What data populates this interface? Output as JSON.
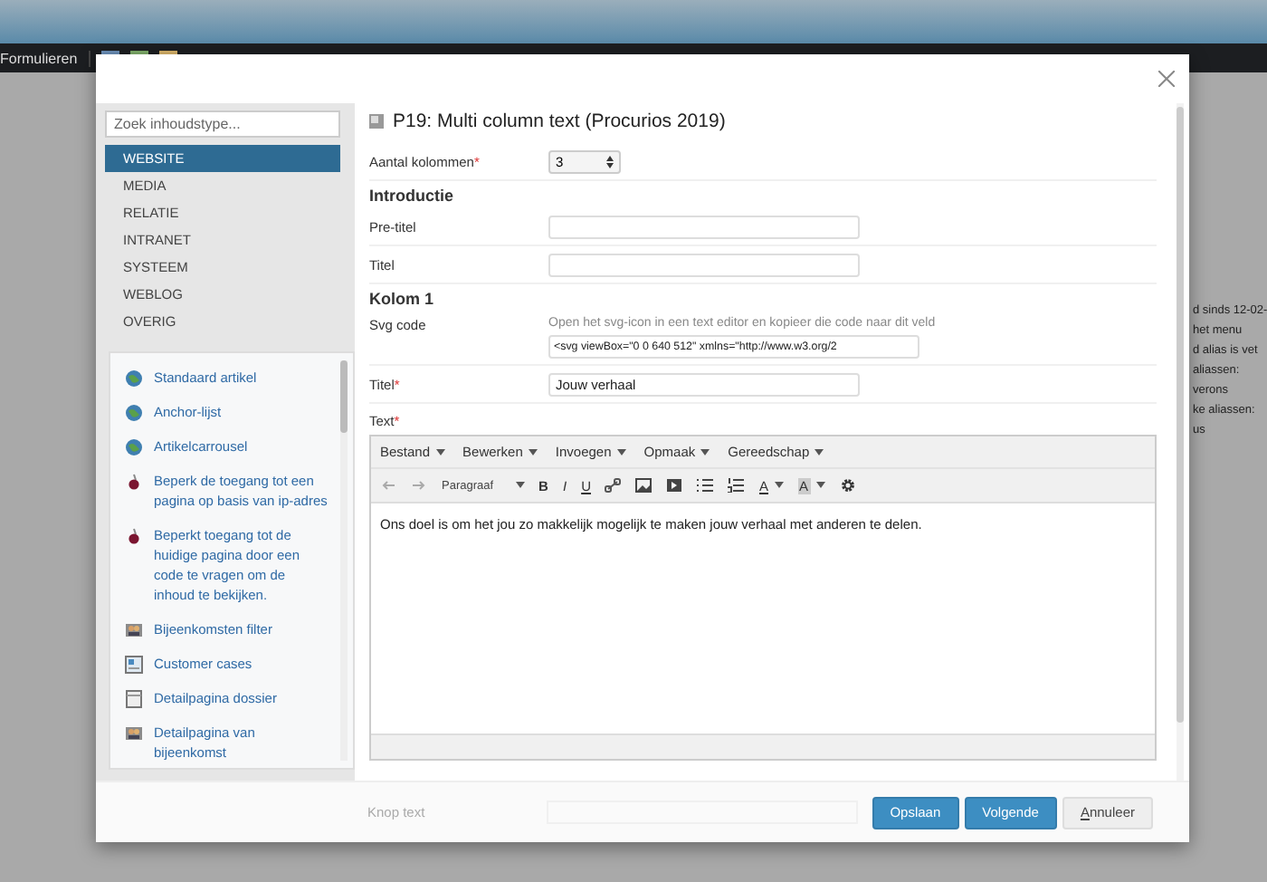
{
  "background": {
    "nav_items": [
      "Formulieren"
    ],
    "side_texts": [
      "d sinds 12-02-",
      "het menu",
      "d alias is vet",
      "aliassen:",
      "verons",
      "ke aliassen:",
      "us"
    ]
  },
  "modal": {
    "sidebar": {
      "search": {
        "placeholder": "Zoek inhoudstype..."
      },
      "categories": [
        {
          "label": "WEBSITE",
          "selected": true
        },
        {
          "label": "MEDIA",
          "selected": false
        },
        {
          "label": "RELATIE",
          "selected": false
        },
        {
          "label": "INTRANET",
          "selected": false
        },
        {
          "label": "SYSTEEM",
          "selected": false
        },
        {
          "label": "WEBLOG",
          "selected": false
        },
        {
          "label": "OVERIG",
          "selected": false
        }
      ],
      "content_types": [
        {
          "kind": "globe",
          "label": "Standaard artikel"
        },
        {
          "kind": "globe",
          "label": "Anchor-lijst"
        },
        {
          "kind": "globe",
          "label": "Artikelcarrousel"
        },
        {
          "kind": "pin",
          "label": "Beperk de toegang tot een pagina op basis van ip-adres"
        },
        {
          "kind": "pin",
          "label": "Beperkt toegang tot de huidige pagina door een code te vragen om de inhoud te bekijken."
        },
        {
          "kind": "group",
          "label": "Bijeenkomsten filter"
        },
        {
          "kind": "card",
          "label": "Customer cases"
        },
        {
          "kind": "page",
          "label": "Detailpagina dossier"
        },
        {
          "kind": "group",
          "label": "Detailpagina van bijeenkomst"
        }
      ]
    },
    "title": "P19: Multi column text (Procurios 2019)",
    "fields": [
      {
        "kind": "select",
        "label": "Aantal kolommen",
        "required_mark": "*",
        "value": "3"
      },
      {
        "kind": "heading",
        "label": "Introductie"
      },
      {
        "kind": "text",
        "label": "Pre-titel"
      },
      {
        "kind": "text",
        "label": "Titel"
      },
      {
        "kind": "heading",
        "label": "Kolom 1"
      },
      {
        "kind": "text",
        "label": "Svg code",
        "help": "Open het svg-icon in een text editor en kopieer die code naar dit veld",
        "value": "<svg viewBox=\"0 0 640 512\" xmlns=\"http://www.w3.org/2"
      },
      {
        "kind": "text",
        "label": "Titel",
        "required_mark": "*",
        "value": "Jouw verhaal"
      },
      {
        "kind": "editor",
        "label": "Text",
        "required_mark": "*",
        "menus": [
          "Bestand",
          "Bewerken",
          "Invoegen",
          "Opmaak",
          "Gereedschap"
        ],
        "block_format": "Paragraaf",
        "format_buttons": [
          "B",
          "I",
          "U"
        ],
        "color_buttons": [
          "A",
          "A"
        ],
        "content": "Ons doel is om het jou zo makkelijk mogelijk te maken jouw verhaal met anderen te delen."
      }
    ],
    "faded_field": {
      "label": "Knop text"
    },
    "buttons": [
      {
        "kind": "primary",
        "label": "Opslaan"
      },
      {
        "kind": "primary",
        "label": "Volgende"
      },
      {
        "kind": "default",
        "label": "Annuleer"
      }
    ]
  }
}
